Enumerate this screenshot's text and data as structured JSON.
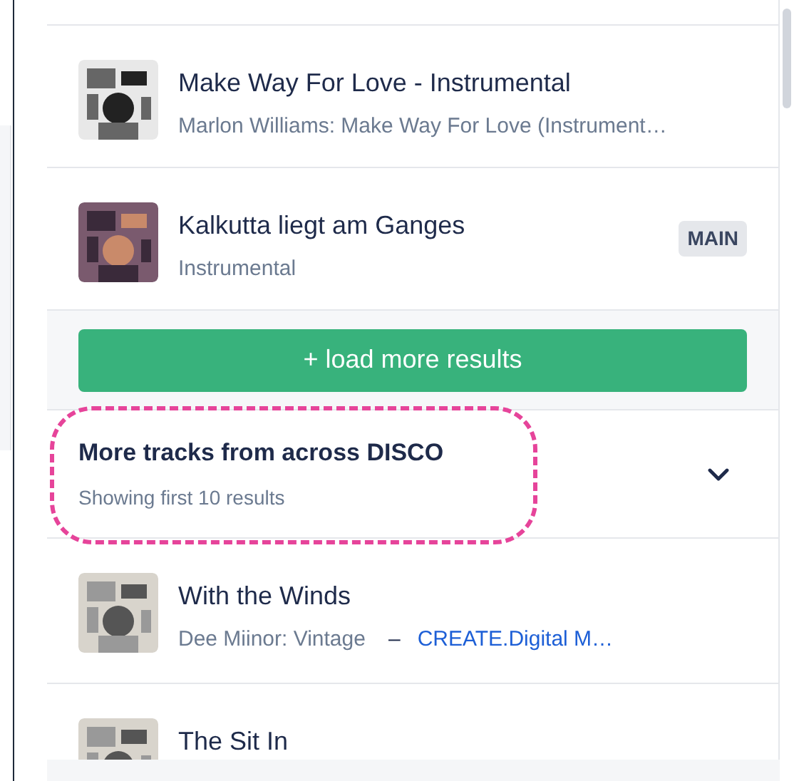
{
  "tracks": [
    {
      "title": "Make Way For Love - Instrumental",
      "subtitle": "Marlon Williams: Make Way For Love (Instrument…"
    },
    {
      "title": "Kalkutta liegt am Ganges",
      "subtitle": "Instrumental",
      "badge": "MAIN"
    }
  ],
  "load_more": {
    "label": "+ load more results"
  },
  "section": {
    "title": "More tracks from across DISCO",
    "subtitle": "Showing first 10 results",
    "expanded": false,
    "highlighted": true,
    "tracks": [
      {
        "title": "With the Winds",
        "subtitle": "Dee Miinor: Vintage",
        "separator": "–",
        "link": "CREATE.Digital M…"
      },
      {
        "title": "The Sit In"
      }
    ]
  }
}
